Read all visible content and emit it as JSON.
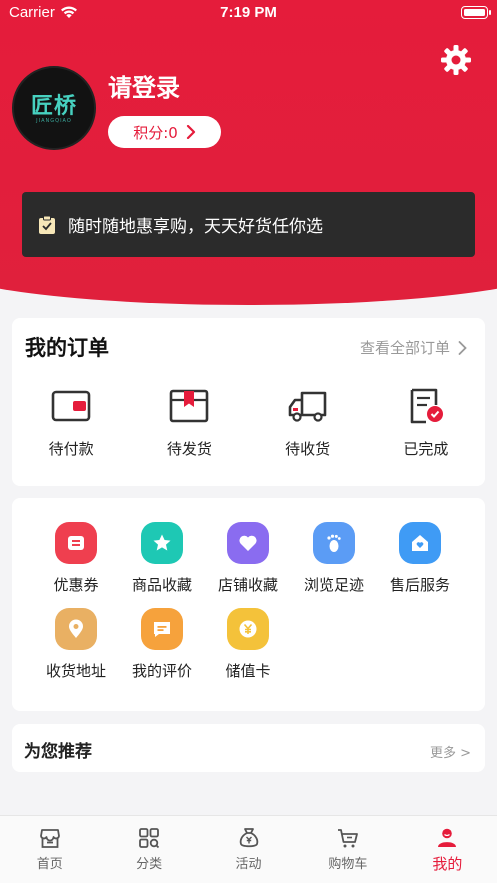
{
  "status_bar": {
    "carrier": "Carrier",
    "time": "7:19 PM"
  },
  "profile": {
    "logo_text": "匠桥",
    "logo_subtext": "JIANGQIAO",
    "login_title": "请登录",
    "points_label": "积分:0"
  },
  "banner": {
    "text": "随时随地惠享购，天天好货任你选"
  },
  "orders": {
    "title": "我的订单",
    "view_all": "查看全部订单",
    "items": [
      {
        "label": "待付款",
        "icon": "wallet-icon"
      },
      {
        "label": "待发货",
        "icon": "package-icon"
      },
      {
        "label": "待收货",
        "icon": "truck-icon"
      },
      {
        "label": "已完成",
        "icon": "completed-document-icon"
      }
    ]
  },
  "tools": [
    {
      "label": "优惠券",
      "icon": "coupon-icon",
      "color": "#ef3f4f"
    },
    {
      "label": "商品收藏",
      "icon": "star-icon",
      "color": "#1ec8b4"
    },
    {
      "label": "店铺收藏",
      "icon": "heart-icon",
      "color": "#8a6cf0"
    },
    {
      "label": "浏览足迹",
      "icon": "footprint-icon",
      "color": "#5b9cf5"
    },
    {
      "label": "售后服务",
      "icon": "home-heart-icon",
      "color": "#3f9bf5"
    },
    {
      "label": "收货地址",
      "icon": "location-pin-icon",
      "color": "#e9b063"
    },
    {
      "label": "我的评价",
      "icon": "comment-icon",
      "color": "#f6a23c"
    },
    {
      "label": "储值卡",
      "icon": "yen-coin-icon",
      "color": "#f4c23a"
    }
  ],
  "recommend": {
    "title": "为您推荐",
    "more": "更多 >"
  },
  "tabbar": [
    {
      "label": "首页",
      "icon": "home-store-icon"
    },
    {
      "label": "分类",
      "icon": "category-grid-icon"
    },
    {
      "label": "活动",
      "icon": "money-bag-icon"
    },
    {
      "label": "购物车",
      "icon": "cart-icon"
    },
    {
      "label": "我的",
      "icon": "profile-icon",
      "active": true
    }
  ],
  "colors": {
    "brand": "#e51c3b",
    "banner_bg": "#2b2b2b"
  }
}
